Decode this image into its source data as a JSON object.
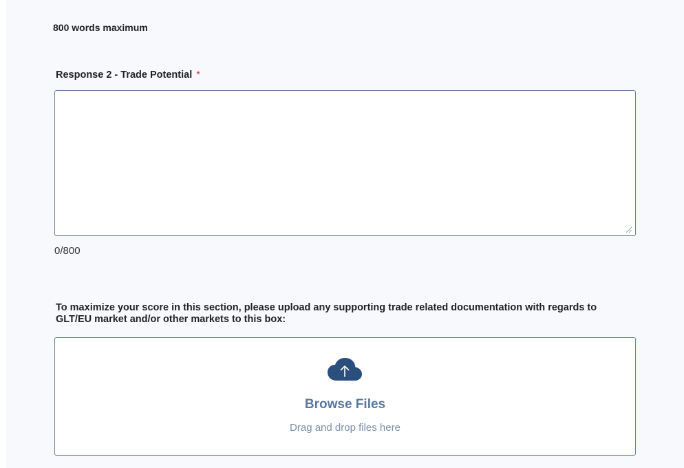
{
  "section": {
    "word_limit_note": "800 words maximum"
  },
  "response_field": {
    "label": "Response 2 - Trade Potential",
    "required_marker": "*",
    "value": "",
    "counter": "0/800"
  },
  "upload": {
    "instructions": "To maximize your score in this section, please upload any supporting trade related documentation with regards to GLT/EU market and/or other markets to this box:",
    "browse_label": "Browse Files",
    "drag_hint": "Drag and drop files here",
    "icon": "cloud-upload-icon"
  },
  "colors": {
    "accent": "#2b4f7c",
    "link_text": "#5878a0",
    "required": "#d9363e",
    "border": "#6a7f9f",
    "panel_bg": "#f7f9fd"
  }
}
